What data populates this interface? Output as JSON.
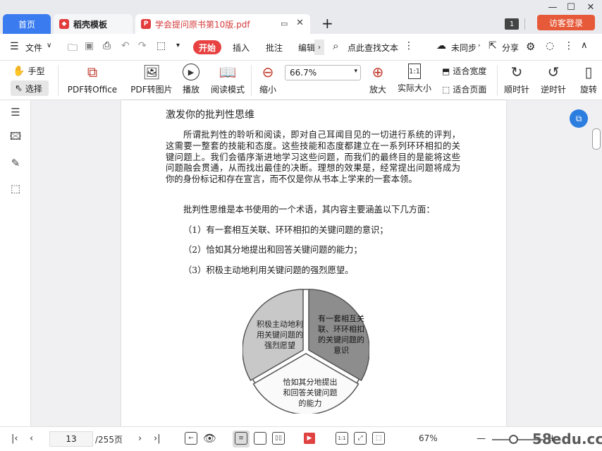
{
  "tabs": {
    "home": "首页",
    "template": "稻壳模板",
    "document": "学会提问原书第10版.pdf",
    "new_tab": "+"
  },
  "header": {
    "page_badge": "1",
    "guest_login": "访客登录"
  },
  "menu": {
    "file": "文件",
    "start": "开始",
    "insert": "插入",
    "annotate": "批注",
    "edit": "编辑",
    "search": "点此查找文本",
    "sync": "未同步",
    "share": "分享"
  },
  "toolbar": {
    "hand": "手型",
    "select": "选择",
    "pdf_to_office": "PDF转Office",
    "pdf_to_image": "PDF转图片",
    "play": "播放",
    "read_mode": "阅读模式",
    "zoom_out": "缩小",
    "zoom_value": "66.7%",
    "zoom_in": "放大",
    "actual_size": "实际大小",
    "fit_width": "适合宽度",
    "fit_page": "适合页面",
    "rotate_cw": "顺时针",
    "rotate_ccw": "逆时针",
    "rotate_page": "旋转"
  },
  "document": {
    "heading": "激发你的批判性思维",
    "para1": "所谓批判性的聆听和阅读，即对自己耳闻目见的一切进行系统的评判，这需要一整套的技能和态度。这些技能和态度都建立在一系列环环相扣的关键问题上。我们会循序渐进地学习这些问题，而我们的最终目的是能将这些问题融会贯通，从而找出最佳的决断。理想的效果是，经常提出问题将成为你的身份标记和存在宣言，而不仅是你从书本上学来的一套本领。",
    "para2": "批判性思维是本书使用的一个术语，其内容主要涵盖以下几方面：",
    "item1": "（1）有一套相互关联、环环相扣的关键问题的意识；",
    "item2": "（2）恰如其分地提出和回答关键问题的能力；",
    "item3": "（3）积极主动地利用关键问题的强烈愿望。",
    "pie_left": "积极主动地利用关键问题的强烈愿望",
    "pie_right": "有一套相互关联、环环相扣的关键问题的意识",
    "pie_bottom": "恰如其分地提出和回答关键问题的能力"
  },
  "status": {
    "current_page": "13",
    "total_pages": "/255页",
    "zoom": "67%"
  },
  "watermark": "58edu.cc",
  "colors": {
    "accent": "#3a7cf0",
    "start_red": "#e84141",
    "guest_orange": "#e65a3a"
  }
}
